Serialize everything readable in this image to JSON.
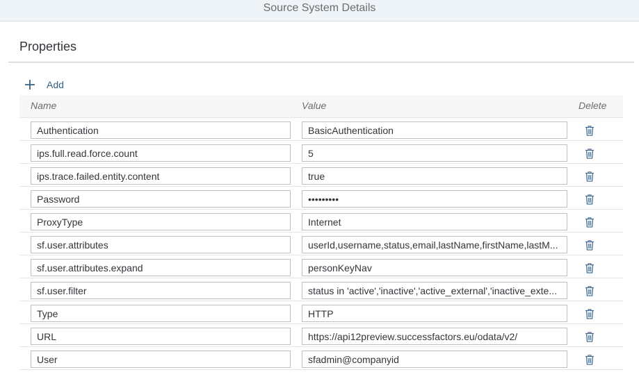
{
  "header": {
    "title": "Source System Details"
  },
  "section": {
    "title": "Properties"
  },
  "toolbar": {
    "add_label": "Add",
    "add_icon": "plus-icon"
  },
  "table": {
    "columns": {
      "name": "Name",
      "value": "Value",
      "delete": "Delete"
    },
    "rows": [
      {
        "name": "Authentication",
        "value": "BasicAuthentication"
      },
      {
        "name": "ips.full.read.force.count",
        "value": "5"
      },
      {
        "name": "ips.trace.failed.entity.content",
        "value": "true"
      },
      {
        "name": "Password",
        "value": "•••••••••"
      },
      {
        "name": "ProxyType",
        "value": "Internet"
      },
      {
        "name": "sf.user.attributes",
        "value": "userId,username,status,email,lastName,firstName,lastM..."
      },
      {
        "name": "sf.user.attributes.expand",
        "value": "personKeyNav"
      },
      {
        "name": "sf.user.filter",
        "value": "status in 'active','inactive','active_external','inactive_exte..."
      },
      {
        "name": "Type",
        "value": "HTTP"
      },
      {
        "name": "URL",
        "value": "https://api12preview.successfactors.eu/odata/v2/"
      },
      {
        "name": "User",
        "value": "sfadmin@companyid"
      }
    ]
  },
  "icons": {
    "delete": "trash-icon"
  },
  "colors": {
    "accent": "#346187",
    "icon": "#4a6f96",
    "header_bg": "#eff4f9"
  }
}
